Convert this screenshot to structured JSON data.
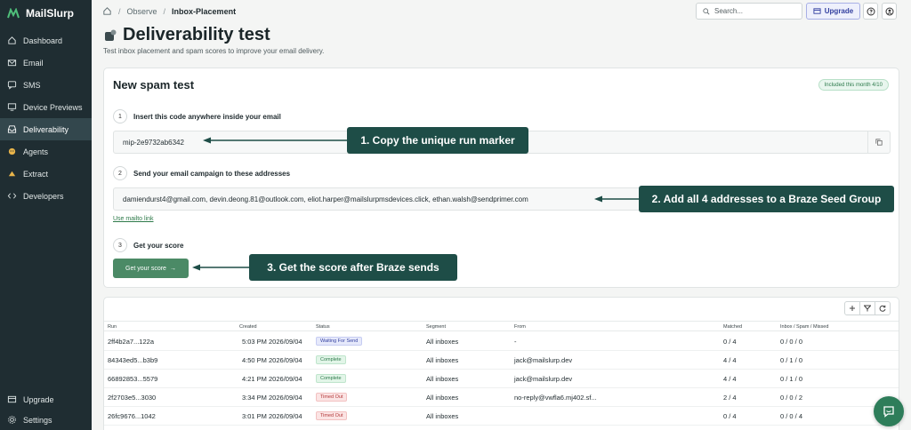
{
  "sidebar": {
    "brand": "MailSlurp",
    "items": [
      {
        "label": "Dashboard",
        "icon": "home-icon"
      },
      {
        "label": "Email",
        "icon": "mail-icon"
      },
      {
        "label": "SMS",
        "icon": "sms-icon"
      },
      {
        "label": "Device Previews",
        "icon": "device-icon"
      },
      {
        "label": "Deliverability",
        "icon": "inbox-icon",
        "active": true
      },
      {
        "label": "Agents",
        "icon": "agent-icon"
      },
      {
        "label": "Extract",
        "icon": "extract-icon"
      },
      {
        "label": "Developers",
        "icon": "code-icon"
      }
    ],
    "bottom": [
      {
        "label": "Upgrade",
        "icon": "upgrade-icon"
      },
      {
        "label": "Settings",
        "icon": "gear-icon"
      }
    ]
  },
  "topbar": {
    "breadcrumb": [
      "Observe",
      "Inbox-Placement"
    ],
    "search_placeholder": "Search...",
    "upgrade_label": "Upgrade"
  },
  "page": {
    "title": "Deliverability test",
    "subtitle": "Test inbox placement and spam scores to improve your email delivery."
  },
  "card": {
    "title": "New spam test",
    "badge": "Included this month 4/10",
    "step1": {
      "num": "1",
      "title": "Insert this code anywhere inside your email",
      "code": "mip-2e9732ab6342"
    },
    "step2": {
      "num": "2",
      "title": "Send your email campaign to these addresses",
      "addresses": "damiendurst4@gmail.com, devin.deong.81@outlook.com, eliot.harper@mailslurpmsdevices.click, ethan.walsh@sendprimer.com",
      "mailto": "Use mailto link"
    },
    "step3": {
      "num": "3",
      "title": "Get your score",
      "button": "Get your score",
      "button_arrow": "→"
    }
  },
  "callouts": {
    "c1": "1. Copy the unique run marker",
    "c2": "2. Add all 4 addresses to a Braze Seed Group",
    "c3": "3. Get the score after Braze sends"
  },
  "table": {
    "columns": [
      "Run",
      "Created",
      "Status",
      "Segment",
      "From",
      "Matched",
      "Inbox / Spam / Missed"
    ],
    "rows": [
      {
        "run": "2ff4b2a7...122a",
        "created": "5:03 PM 2026/09/04",
        "status": "Waiting For Send",
        "kind": "wait",
        "segment": "All inboxes",
        "from": "-",
        "matched": "0 / 4",
        "ism": "0 / 0 / 0"
      },
      {
        "run": "84343ed5...b3b9",
        "created": "4:50 PM 2026/09/04",
        "status": "Complete",
        "kind": "ok",
        "segment": "All inboxes",
        "from": "jack@mailslurp.dev",
        "matched": "4 / 4",
        "ism": "0 / 1 / 0"
      },
      {
        "run": "66892853...5579",
        "created": "4:21 PM 2026/09/04",
        "status": "Complete",
        "kind": "ok",
        "segment": "All inboxes",
        "from": "jack@mailslurp.dev",
        "matched": "4 / 4",
        "ism": "0 / 1 / 0"
      },
      {
        "run": "2f2703e5...3030",
        "created": "3:34 PM 2026/09/04",
        "status": "Timed Out",
        "kind": "timeout",
        "segment": "All inboxes",
        "from": "no-reply@vwfla6.mj402.sf...",
        "matched": "2 / 4",
        "ism": "0 / 0 / 2"
      },
      {
        "run": "26fc9676...1042",
        "created": "3:01 PM 2026/09/04",
        "status": "Timed Out",
        "kind": "timeout",
        "segment": "All inboxes",
        "from": "",
        "matched": "0 / 4",
        "ism": "0 / 0 / 4"
      }
    ]
  },
  "colors": {
    "sidebar_bg": "#1f2d32",
    "accent_green": "#4b8a66",
    "callout_bg": "#1e4d47"
  }
}
